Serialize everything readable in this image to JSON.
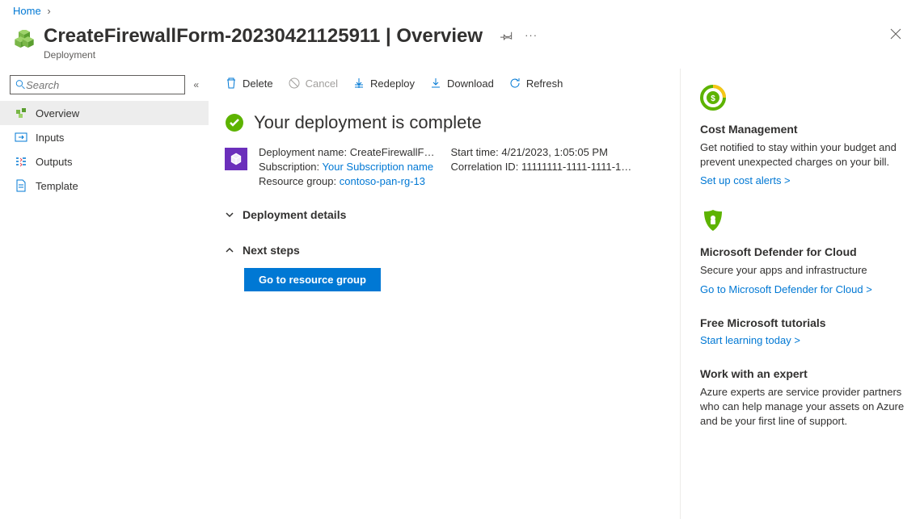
{
  "breadcrumb": {
    "home": "Home"
  },
  "header": {
    "title": "CreateFirewallForm-20230421125911 | Overview",
    "subtitle": "Deployment"
  },
  "sidebar": {
    "search_placeholder": "Search",
    "items": [
      {
        "label": "Overview"
      },
      {
        "label": "Inputs"
      },
      {
        "label": "Outputs"
      },
      {
        "label": "Template"
      }
    ]
  },
  "toolbar": {
    "delete": "Delete",
    "cancel": "Cancel",
    "redeploy": "Redeploy",
    "download": "Download",
    "refresh": "Refresh"
  },
  "status": {
    "text": "Your deployment is complete"
  },
  "details": {
    "deployment_name_label": "Deployment name:",
    "deployment_name_value": "CreateFirewallF…",
    "subscription_label": "Subscription:",
    "subscription_value": "Your Subscription name",
    "resource_group_label": "Resource group:",
    "resource_group_value": "contoso-pan-rg-13",
    "start_time_label": "Start time:",
    "start_time_value": "4/21/2023, 1:05:05 PM",
    "correlation_id_label": "Correlation ID:",
    "correlation_id_value": "11111111-1111-1111-1…"
  },
  "sections": {
    "deployment_details": "Deployment details",
    "next_steps": "Next steps",
    "go_to_resource_group": "Go to resource group"
  },
  "aside": {
    "cost_title": "Cost Management",
    "cost_text": "Get notified to stay within your budget and prevent unexpected charges on your bill.",
    "cost_link": "Set up cost alerts >",
    "defender_title": "Microsoft Defender for Cloud",
    "defender_text": "Secure your apps and infrastructure",
    "defender_link": "Go to Microsoft Defender for Cloud >",
    "tutorials_title": "Free Microsoft tutorials",
    "tutorials_link": "Start learning today >",
    "expert_title": "Work with an expert",
    "expert_text": "Azure experts are service provider partners who can help manage your assets on Azure and be your first line of support."
  }
}
